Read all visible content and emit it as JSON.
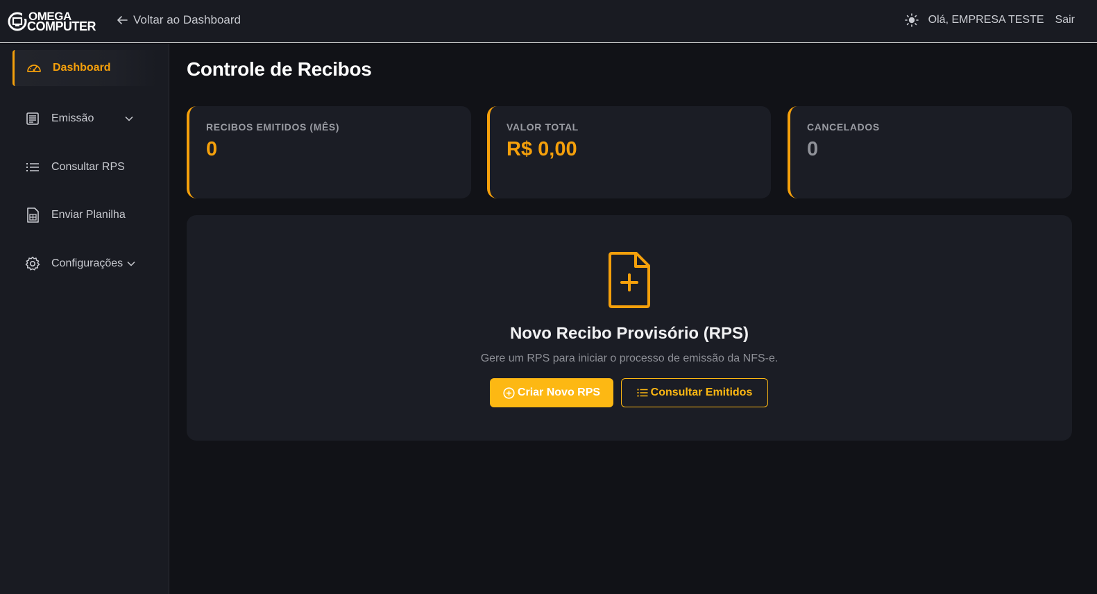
{
  "header": {
    "logo_line1": "OMEGA",
    "logo_line2": "COMPUTER",
    "back_label": "Voltar ao Dashboard",
    "greeting": "Olá, EMPRESA TESTE",
    "logout_label": "Sair"
  },
  "sidebar": {
    "items": [
      {
        "label": "Dashboard",
        "icon": "gauge-icon",
        "active": true
      },
      {
        "label": "Emissão",
        "icon": "document-list-icon",
        "has_submenu": true
      },
      {
        "label": "Consultar RPS",
        "icon": "list-icon"
      },
      {
        "label": "Enviar Planilha",
        "icon": "spreadsheet-icon"
      },
      {
        "label": "Configurações",
        "icon": "gear-icon",
        "has_submenu": true
      }
    ]
  },
  "main": {
    "title": "Controle de Recibos",
    "stats": [
      {
        "label": "RECIBOS EMITIDOS (MÊS)",
        "value": "0"
      },
      {
        "label": "VALOR TOTAL",
        "value": "R$ 0,00"
      },
      {
        "label": "CANCELADOS",
        "value": "0"
      }
    ],
    "hero": {
      "title": "Novo Recibo Provisório (RPS)",
      "subtitle": "Gere um RPS para iniciar o processo de emissão da NFS-e.",
      "primary_button": "Criar Novo RPS",
      "secondary_button": "Consultar Emitidos"
    }
  },
  "colors": {
    "accent": "#f5a00b",
    "button": "#fdb813",
    "background": "#111217",
    "panel": "#1b1d25"
  }
}
